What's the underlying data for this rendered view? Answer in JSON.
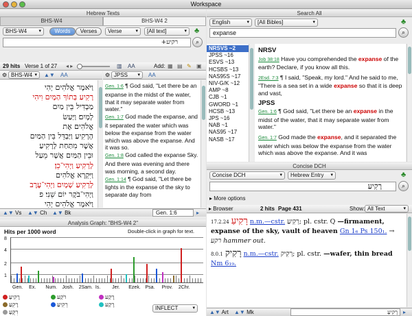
{
  "window": {
    "title": "Workspace"
  },
  "left": {
    "header": "Hebrew Texts",
    "tabs": [
      "BHS-W4",
      "BHS-W4 2"
    ],
    "version_select": "BHS-W4",
    "mode_words": "Words",
    "mode_verses": "Verses",
    "scope_select": "Verse",
    "range_select": "[All text]",
    "search_text": "רקיע+",
    "hits_label": "29 hits",
    "verse_label": "Verse 1 of 27",
    "add_label": "Add:",
    "pane_left_select": "BHS-W4",
    "pane_right_select": "JPSS",
    "hebrew_lines": [
      "וַיֹּאמֶר אֱלֹהִים יְהִי",
      "רָקִיעַ בְּתוֹךְ הַמָּיִם וִיהִי",
      "מַבְדִּיל בֵּין מַיִם",
      "לָמָיִם׃ וַיַּעַשׂ",
      "אֱלֹהִים אֶת",
      "הָרָקִיעַ וַיַּבְדֵּל בֵּין הַמַּיִם",
      "אֲשֶׁר מִתַּחַת לָרָקִיעַ",
      "וּבֵין הַמַּיִם אֲשֶׁר מֵעַל",
      "לָרָקִיעַ וַיְהִי־כֵן׃",
      "וַיִּקְרָא אֱלֹהִים",
      "לָרָקִיעַ שָׁמָיִם וַיְהִי־עֶרֶב",
      "וַיְהִי־בֹקֶר יוֹם שֵׁנִי׃ פ",
      "וַיֹּאמֶר אֱלֹהִים יְהִי"
    ],
    "english": [
      {
        "ref": "Gen. 1:6",
        "text": "¶ God said, \"Let there be an expanse in the midst of the water, that it may separate water from water.\""
      },
      {
        "ref": "Gen. 1:7",
        "text": "God made the expanse, and it separated the water which was below the expanse from the water which was above the expanse. And it was so."
      },
      {
        "ref": "Gen. 1:8",
        "text": "God called the expanse Sky. And there was evening and there was morning, a second day."
      },
      {
        "ref": "Gen. 1:14",
        "text": "¶ God said, \"Let there be lights in the expanse of the sky to separate day from"
      }
    ],
    "nav": {
      "vs": "Vs",
      "ch": "Ch",
      "bk": "Bk",
      "location": "Gen. 1:6"
    }
  },
  "graph": {
    "header": "Analysis Graph: \"BHS-W4 2\"",
    "ylabel": "Hits per 1000 word",
    "hint": "Double-click in graph for text.",
    "yticks": [
      "8",
      "4",
      "2",
      "1"
    ],
    "books": [
      "Gen.",
      "Ex.",
      "Num.",
      "Josh.",
      "2Sam.",
      "Is.",
      "Jer.",
      "Ezek.",
      "Psa.",
      "Prov.",
      "2Chr."
    ],
    "legend": [
      {
        "word": "רָקִיעַ",
        "color": "#d02020"
      },
      {
        "word": "רֹקַע",
        "color": "#2c9c2c"
      },
      {
        "word": "רָקַע",
        "color": "#c030c0"
      },
      {
        "word": "רָקִעַ",
        "color": "#8a6a2a"
      },
      {
        "word": "רְקִיעַ",
        "color": "#1a58d8"
      },
      {
        "word": "רֶקַע",
        "color": "#20c0c0"
      },
      {
        "word": "רִקֻּעַ",
        "color": "#9a9a9a"
      }
    ],
    "inflect": "INFLECT",
    "bars": [
      {
        "pos": 3,
        "h": 0.2,
        "color": "#1a58d8"
      },
      {
        "pos": 5,
        "h": 0.35,
        "color": "#d02020"
      },
      {
        "pos": 9,
        "h": 0.15,
        "color": "#20c0c0"
      },
      {
        "pos": 14,
        "h": 0.25,
        "color": "#2c9c2c"
      },
      {
        "pos": 22,
        "h": 0.12,
        "color": "#c030c0"
      },
      {
        "pos": 37,
        "h": 0.2,
        "color": "#1a58d8"
      },
      {
        "pos": 52,
        "h": 0.3,
        "color": "#d02020"
      },
      {
        "pos": 60,
        "h": 0.18,
        "color": "#20c0c0"
      },
      {
        "pos": 64,
        "h": 0.55,
        "color": "#2c9c2c"
      },
      {
        "pos": 71,
        "h": 0.4,
        "color": "#d02020"
      },
      {
        "pos": 76,
        "h": 0.3,
        "color": "#1a58d8"
      },
      {
        "pos": 79,
        "h": 0.22,
        "color": "#c030c0"
      },
      {
        "pos": 85,
        "h": 0.15,
        "color": "#8a6a2a"
      },
      {
        "pos": 89,
        "h": 0.75,
        "color": "#d02020"
      }
    ]
  },
  "search": {
    "header": "Search All",
    "lang_select": "English",
    "bibles_select": "[All Bibles]",
    "query": "expanse",
    "versions": [
      {
        "label": "NRSVS ~2",
        "selected": true
      },
      {
        "label": "JPSS ~16",
        "selected": false
      },
      {
        "label": "ESVS ~13",
        "selected": false
      },
      {
        "label": "HCSBS ~13",
        "selected": false
      },
      {
        "label": "NAS95S ~17",
        "selected": false
      },
      {
        "label": "NIV-G/K ~12",
        "selected": false
      },
      {
        "label": "AMP ~8",
        "selected": false
      },
      {
        "label": "CJB ~1",
        "selected": false
      },
      {
        "label": "GWORD ~1",
        "selected": false
      },
      {
        "label": "HCSB ~13",
        "selected": false
      },
      {
        "label": "JPS ~16",
        "selected": false
      },
      {
        "label": "NAB ~1",
        "selected": false
      },
      {
        "label": "NAS95 ~17",
        "selected": false
      },
      {
        "label": "NASB ~17",
        "selected": false
      }
    ],
    "results": [
      {
        "heading": "NRSV",
        "ref": "Job 38:18",
        "text_pre": "Have you comprehended the ",
        "hit": "expanse",
        "text_post": " of the earth? Declare, if you know all this."
      },
      {
        "heading": "",
        "ref": "2Esd. 7:3",
        "text_pre": "¶ I said, \"Speak, my lord.\" And he said to me, \"There is a sea set in a wide ",
        "hit": "expanse",
        "text_post": " so that it is deep and vast,"
      },
      {
        "heading": "JPSS",
        "ref": "Gen. 1:6",
        "text_pre": "¶ God said, \"Let there be an ",
        "hit": "expanse",
        "text_post": " in the midst of the water, that it may separate water from water.\""
      },
      {
        "heading": "",
        "ref": "Gen. 1:7",
        "text_pre": "God made the ",
        "hit": "expanse",
        "text_post": ", and it separated the water which was below the expanse from the water which was above the expanse. And it was"
      }
    ]
  },
  "dch": {
    "header": "Concise DCH",
    "dict_select": "Concise DCH",
    "entry_select": "Hebrew Entry",
    "entry_text": "רָקִיעַ",
    "more_options": "More options",
    "browser": "Browser",
    "hits": "2 hits",
    "page": "Page 431",
    "show_label": "Show:",
    "show_select": "All Text",
    "entry1": {
      "head": "רָקִיעַ",
      "num": "17.2.24",
      "abbr": "n.m.—cstr.",
      "rest": "רְקִיעַ; pl. cstr. Q",
      "def": "—firmament, expanse of the sky, vault of heaven",
      "refs": "Gn 1₆ Ps 150₁.",
      "tail": "→ רקע hammer out."
    },
    "entry2": {
      "head": "רָקִיק",
      "num": "8.0.1",
      "abbr": "n.m.—cstr.",
      "rest": "רְקִיק; pl. cstr.",
      "def": "—wafer, thin bread",
      "refs": "Nm 6₁₉."
    },
    "nav": {
      "art": "Art",
      "mk": "Mk",
      "field": "רָקִיעַ"
    }
  }
}
